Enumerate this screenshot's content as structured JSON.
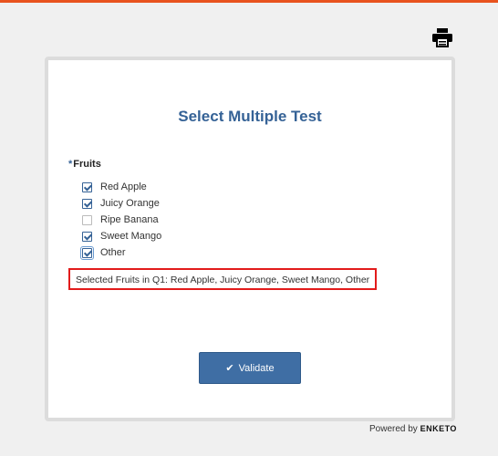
{
  "icons": {
    "print": "printer-icon"
  },
  "colors": {
    "accent_bar": "#e8531e",
    "title": "#356296",
    "button": "#3f6ea4",
    "highlight_border": "#e21b1b"
  },
  "form": {
    "title": "Select Multiple Test",
    "question": {
      "required_marker": "*",
      "label": "Fruits"
    },
    "options": [
      {
        "label": "Red Apple",
        "checked": true
      },
      {
        "label": "Juicy Orange",
        "checked": true
      },
      {
        "label": "Ripe Banana",
        "checked": false
      },
      {
        "label": "Sweet Mango",
        "checked": true
      },
      {
        "label": "Other",
        "checked": true
      }
    ],
    "note": "Selected Fruits in Q1: Red Apple, Juicy Orange, Sweet Mango, Other",
    "validate_label": "Validate"
  },
  "footer": {
    "powered_by": "Powered by",
    "brand": "ENKETO"
  }
}
